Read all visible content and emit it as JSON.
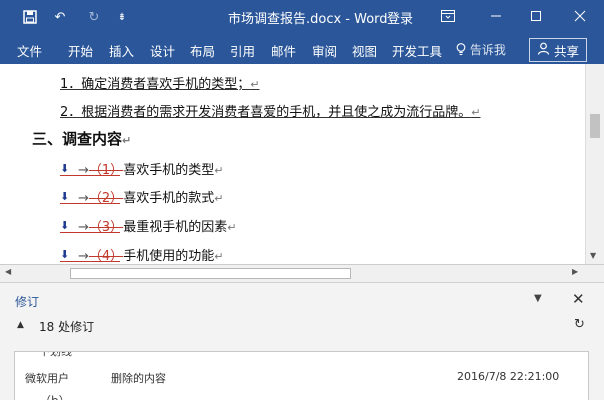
{
  "titlebar": {
    "title": "市场调查报告.docx - Word",
    "login": "登录",
    "save_icon": "save-icon",
    "undo_icon": "undo-icon",
    "redo_icon": "redo-icon",
    "customize_icon": "customize-qat-icon"
  },
  "ribbon": {
    "tabs": [
      "文件",
      "开始",
      "插入",
      "设计",
      "布局",
      "引用",
      "邮件",
      "审阅",
      "视图",
      "开发工具"
    ],
    "tell_me": "告诉我",
    "share": "共享"
  },
  "document": {
    "lines": [
      {
        "text": "1．确定消费者喜欢手机的类型；",
        "mark": "↵"
      },
      {
        "text": "2．根据消费者的需求开发消费者喜爱的手机，并且使之成为流行品牌。",
        "mark": "↵"
      },
      {
        "text": "三、调查内容",
        "mark": "↵"
      },
      {
        "deleted": "（1）",
        "text": "喜欢手机的类型",
        "mark": "↵"
      },
      {
        "deleted": "（2）",
        "text": "喜欢手机的款式",
        "mark": "↵"
      },
      {
        "deleted": "（3）",
        "text": "最重视手机的因素",
        "mark": "↵"
      },
      {
        "deleted": "（4）",
        "text": "手机使用的功能",
        "mark": "↵"
      }
    ],
    "tab_arrow": "→"
  },
  "revisions": {
    "title": "修订",
    "count": "18 处修订",
    "card": {
      "top_fragment": "下划线",
      "author": "微软用户",
      "type": "删除的内容",
      "date": "2016/7/8 22:21:00",
      "bottom_fragment": "（b）"
    }
  }
}
